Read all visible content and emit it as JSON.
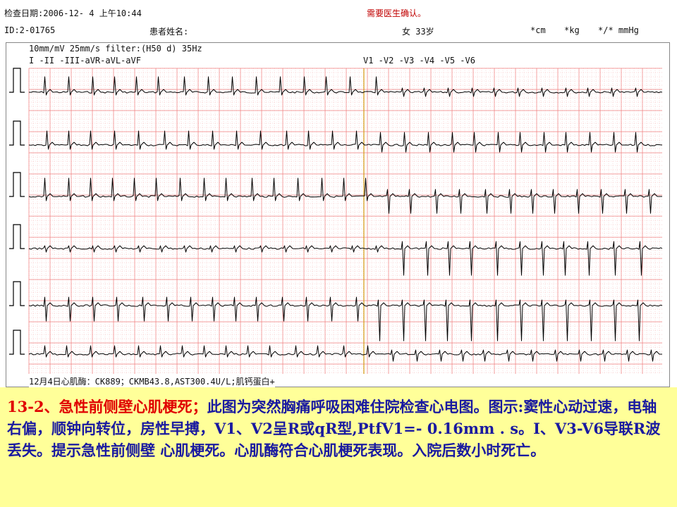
{
  "header": {
    "exam_date": "检查日期:2006-12- 4  上午10:44",
    "alert": "需要医生确认。",
    "id": "ID:2-01765",
    "patient_name_label": "患者姓名:",
    "sex_age": "女   33岁",
    "height": "*cm",
    "weight": "*kg",
    "bp": "*/* mmHg"
  },
  "ecg": {
    "settings": "10mm/mV 25mm/s filter:(H50 d) 35Hz",
    "limb_leads": "I  -II -III-aVR-aVL-aVF",
    "chest_leads": "V1 -V2 -V3 -V4 -V5 -V6",
    "footer": "12月4日心肌酶：CK889；CKMB43.8,AST300.4U/L;肌钙蛋白+",
    "grid_color": "#f08080",
    "trace_color": "#000000",
    "divider_color": "#d4a017"
  },
  "caption": {
    "title": "13-2、急性前侧壁心肌梗死；",
    "body": "此图为突然胸痛呼吸困难住院检查心电图。图示:窦性心动过速，电轴右偏，顺钟向转位，房性早搏，V1、V2呈R或qR型,PtfV1=- 0.16mm . s。I、V3-V6导联R波丢失。提示急性前侧壁 心肌梗死。心肌酶符合心肌梗死表现。入院后数小时死亡。",
    "title_color": "#e00000",
    "body_color": "#1a1aa0",
    "background": "#ffff99"
  }
}
